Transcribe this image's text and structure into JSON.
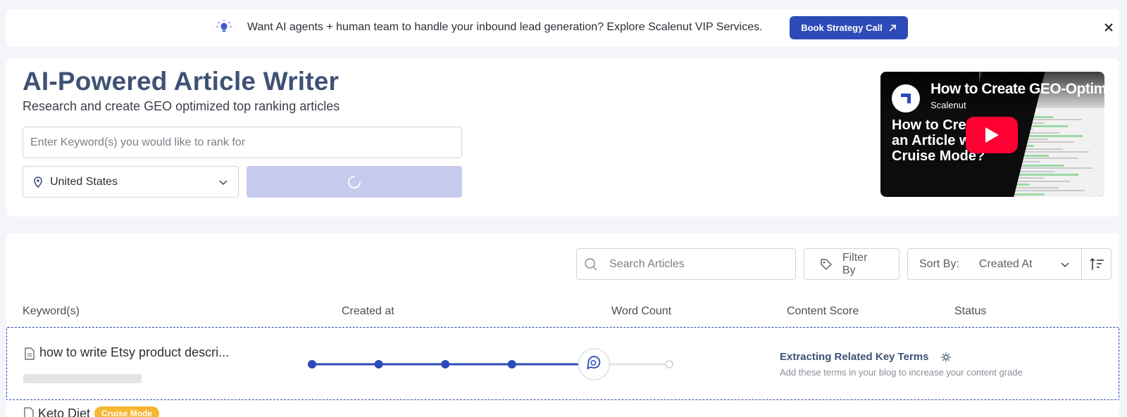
{
  "banner": {
    "icon": "lightbulb-icon",
    "message": "Want AI agents + human team to handle your inbound lead generation? Explore Scalenut VIP Services.",
    "cta_label": "Book Strategy Call",
    "close_icon": "close-icon"
  },
  "hero": {
    "title": "AI-Powered Article Writer",
    "subtitle": "Research and create GEO optimized top ranking articles",
    "keyword_placeholder": "Enter Keyword(s) you would like to rank for",
    "keyword_value": "",
    "country": "United States",
    "submit_state": "loading"
  },
  "video": {
    "title": "How to Create GEO-Optim",
    "channel": "Scalenut",
    "overlay_line1": "How to Crea",
    "overlay_line2": "an Article w",
    "overlay_line3": "Cruise Mode?"
  },
  "toolbar": {
    "search_placeholder": "Search Articles",
    "filter_label": "Filter By",
    "sort_label": "Sort By:",
    "sort_value": "Created At"
  },
  "table": {
    "headers": {
      "keyword": "Keyword(s)",
      "created_at": "Created at",
      "word_count": "Word Count",
      "content_score": "Content Score",
      "status": "Status"
    },
    "rows": [
      {
        "keyword": "how to write Etsy product descri...",
        "progress_steps_total": 6,
        "progress_steps_done": 5,
        "status_title": "Extracting Related Key Terms",
        "status_subtitle": "Add these terms in your blog to increase your content grade"
      },
      {
        "keyword": "Keto Diet",
        "badge": "Cruise Mode"
      }
    ]
  },
  "colors": {
    "brand": "#2c4ab8",
    "title": "#3f5275",
    "submit_disabled": "#c6cbed",
    "youtube_red": "#ff0033",
    "badge": "#f7b731"
  }
}
